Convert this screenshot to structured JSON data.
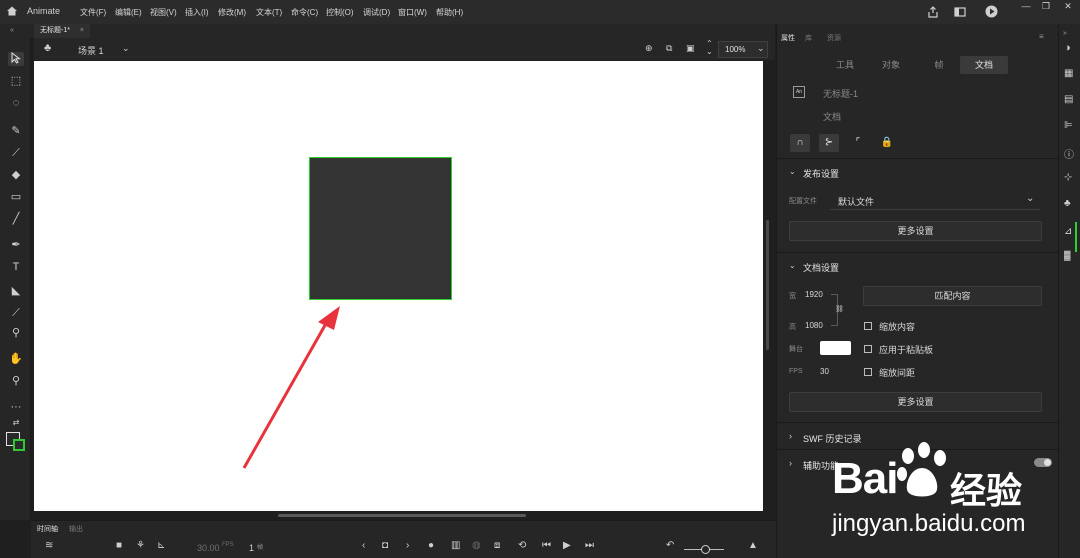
{
  "menubar": {
    "app_name": "Animate",
    "items": [
      "文件(F)",
      "编辑(E)",
      "视图(V)",
      "插入(I)",
      "修改(M)",
      "文本(T)",
      "命令(C)",
      "控制(O)",
      "调试(D)",
      "窗口(W)",
      "帮助(H)"
    ]
  },
  "document": {
    "tab_title": "无标题-1*",
    "scene": "场景 1",
    "zoom": "100%"
  },
  "properties_panel": {
    "header_tabs": [
      "属性",
      "库",
      "资源"
    ],
    "tabs": [
      "工具",
      "对象",
      "帧",
      "文档"
    ],
    "active_tab": "文档",
    "doc_name": "无标题-1",
    "doc_type": "文档",
    "publish": {
      "title": "发布设置",
      "profile_label": "配置文件",
      "profile_value": "默认文件",
      "more_label": "更多设置"
    },
    "doc_settings": {
      "title": "文档设置",
      "width_label": "宽",
      "width_value": "1920",
      "height_label": "高",
      "height_value": "1080",
      "match_content": "匹配内容",
      "scale_content": "缩放内容",
      "apply_pasteboard": "应用于粘贴板",
      "scale_spacing": "缩放间距",
      "stage_label": "舞台",
      "stage_color": "#ffffff",
      "fps_label": "FPS",
      "fps_value": "30",
      "more_label": "更多设置"
    },
    "swf_history": "SWF 历史记录",
    "accessibility": "辅助功能"
  },
  "timeline": {
    "tabs": [
      "时间轴",
      "输出"
    ],
    "fps": "30.00",
    "fps_unit": "FPS",
    "frame": "1",
    "frame_unit": "帧"
  },
  "annotation": {
    "arrow_color": "#e8323c"
  },
  "watermark": {
    "text1": "Bai",
    "text2": "经验",
    "url": "jingyan.baidu.com"
  }
}
